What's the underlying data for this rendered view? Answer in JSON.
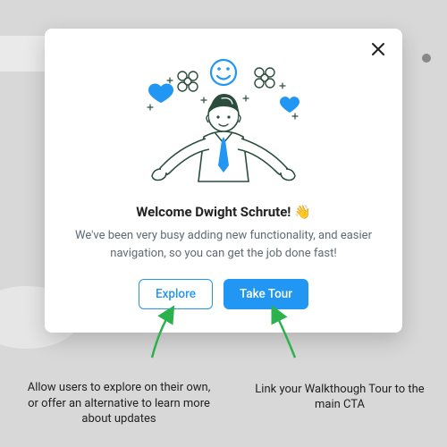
{
  "modal": {
    "title": "Welcome Dwight Schrute! 👋",
    "description": "We've been very busy adding new functionality, and easier navigation, so you can get the job done fast!",
    "buttons": {
      "secondary": "Explore",
      "primary": "Take Tour"
    }
  },
  "annotations": {
    "left": "Allow users to explore on their own, or offer an alternative to learn more about updates",
    "right": "Link your Walkthough Tour to the main CTA"
  },
  "colors": {
    "accent": "#2196f3",
    "arrow": "#2bb24c"
  }
}
